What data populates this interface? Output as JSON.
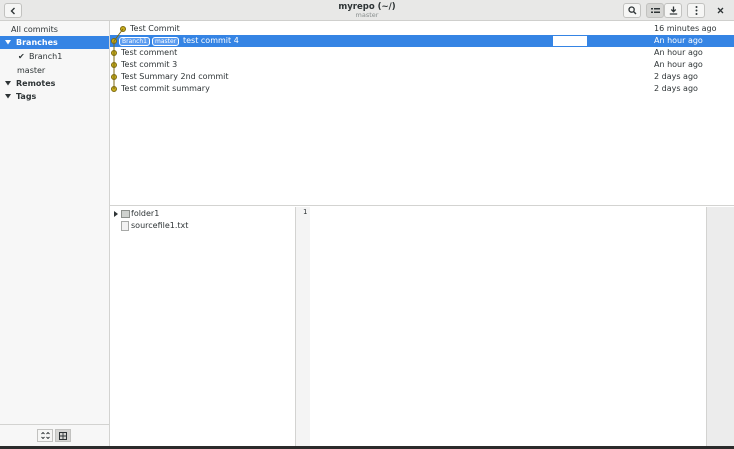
{
  "header": {
    "title": "myrepo (~/)",
    "subtitle": "master",
    "back_icon": "chevron-left-icon",
    "search_icon": "search-icon",
    "list_icon": "list-view-icon",
    "download_icon": "download-icon",
    "menu_icon": "kebab-menu-icon",
    "close_icon": "close-icon"
  },
  "sidebar": {
    "all_commits": "All commits",
    "branches_label": "Branches",
    "branches": [
      {
        "name": "Branch1",
        "checked": true
      },
      {
        "name": "master",
        "checked": false
      }
    ],
    "remotes_label": "Remotes",
    "tags_label": "Tags"
  },
  "commits": [
    {
      "message": "Test Commit",
      "date": "16 minutes ago",
      "badges": [],
      "selected": false
    },
    {
      "message": "test commit 4",
      "date": "An hour ago",
      "badges": [
        "Branch1",
        "master"
      ],
      "selected": true
    },
    {
      "message": "Test comment",
      "date": "An hour ago",
      "badges": [],
      "selected": false
    },
    {
      "message": "Test commit 3",
      "date": "An hour ago",
      "badges": [],
      "selected": false
    },
    {
      "message": "Test Summary 2nd commit",
      "date": "2 days ago",
      "badges": [],
      "selected": false
    },
    {
      "message": "Test commit summary",
      "date": "2 days ago",
      "badges": [],
      "selected": false
    }
  ],
  "files": [
    {
      "name": "folder1",
      "type": "folder"
    },
    {
      "name": "sourcefile1.txt",
      "type": "file"
    }
  ],
  "editor": {
    "line_numbers": [
      "1"
    ]
  },
  "colors": {
    "accent": "#3584e4",
    "graph_dot": "#c8ad1e"
  }
}
